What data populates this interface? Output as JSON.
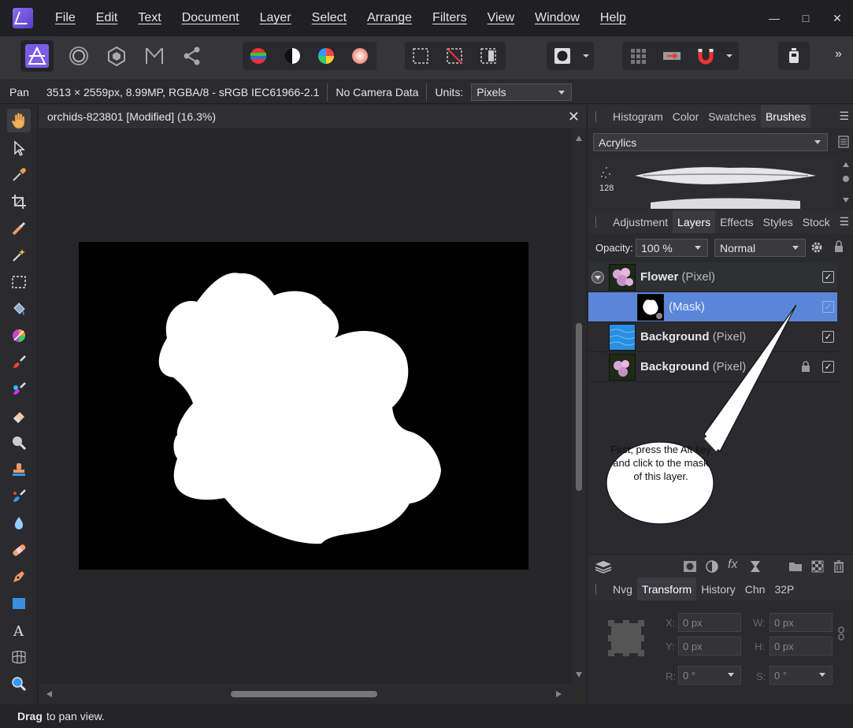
{
  "menu": [
    "File",
    "Edit",
    "Text",
    "Document",
    "Layer",
    "Select",
    "Arrange",
    "Filters",
    "View",
    "Window",
    "Help"
  ],
  "window_controls": {
    "minimize": "—",
    "maximize": "□",
    "close": "✕"
  },
  "toolbar": {
    "more": "»"
  },
  "context": {
    "tool": "Pan",
    "doc_info": "3513 × 2559px, 8.99MP, RGBA/8 - sRGB IEC61966-2.1",
    "camera": "No Camera Data",
    "units_label": "Units:",
    "units_value": "Pixels"
  },
  "document": {
    "title": "orchids-823801 [Modified] (16.3%)",
    "close": "✕"
  },
  "status": {
    "bold": "Drag",
    "text": "to pan view."
  },
  "top_panel": {
    "tabs": [
      "Histogram",
      "Color",
      "Swatches",
      "Brushes"
    ],
    "active": "Brushes",
    "category": "Acrylics",
    "brush_size": "128"
  },
  "layers_panel": {
    "tabs": [
      "Adjustment",
      "Layers",
      "Effects",
      "Styles",
      "Stock"
    ],
    "active": "Layers",
    "opacity_label": "Opacity:",
    "opacity_value": "100 %",
    "blend_mode": "Normal",
    "layers": [
      {
        "name": "Flower",
        "type": "(Pixel)",
        "checked": true,
        "selected": false
      },
      {
        "name": "",
        "type": "(Mask)",
        "checked": true,
        "selected": true
      },
      {
        "name": "Background",
        "type": "(Pixel)",
        "checked": true,
        "selected": false
      },
      {
        "name": "Background",
        "type": "(Pixel)",
        "checked": true,
        "selected": false,
        "locked": true
      }
    ]
  },
  "bottom_panel": {
    "tabs": [
      "Nvg",
      "Transform",
      "History",
      "Chn",
      "32P"
    ],
    "active": "Transform",
    "fields": {
      "x_label": "X:",
      "x": "0 px",
      "y_label": "Y:",
      "y": "0 px",
      "w_label": "W:",
      "w": "0 px",
      "h_label": "H:",
      "h": "0 px",
      "r_label": "R:",
      "r": "0 °",
      "s_label": "S:",
      "s": "0 °"
    }
  },
  "callout": "First, press the Alt key and click to the mask of this layer."
}
